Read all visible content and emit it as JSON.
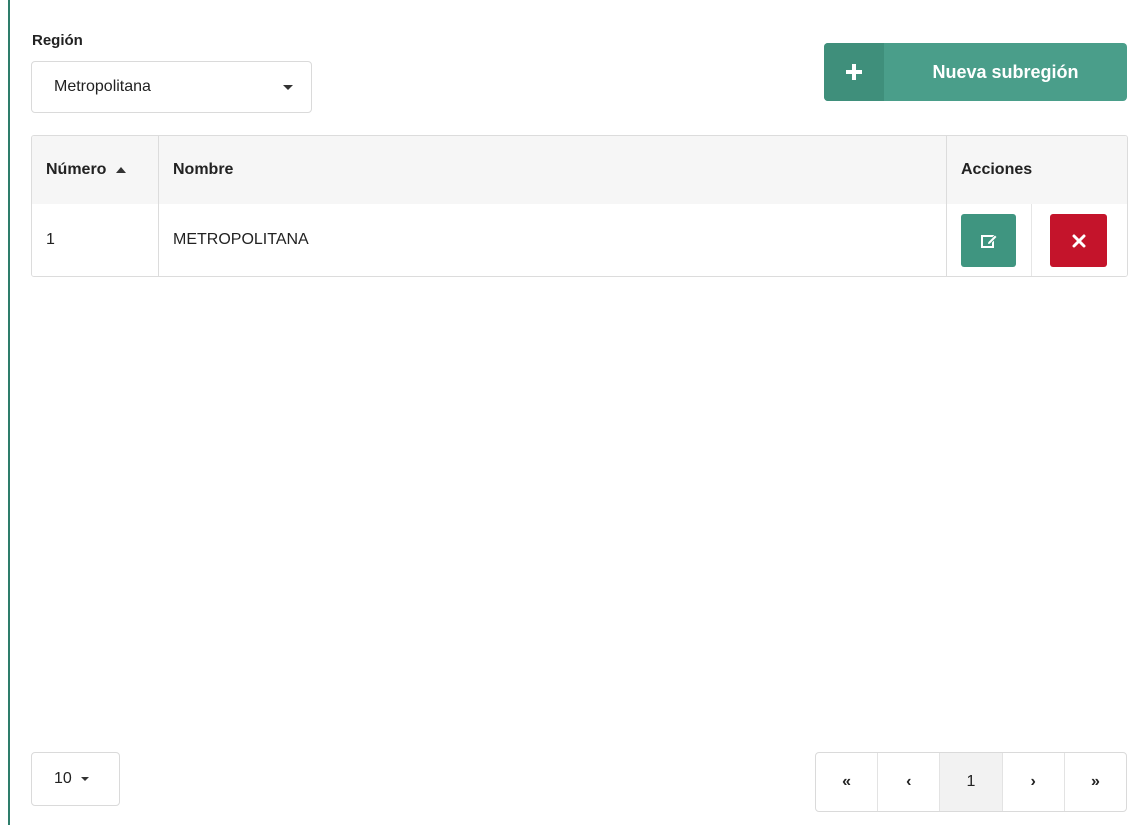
{
  "filter": {
    "label": "Región",
    "selected": "Metropolitana"
  },
  "toolbar": {
    "new_label": "Nueva subregión"
  },
  "table": {
    "columns": {
      "number": "Número",
      "name": "Nombre",
      "actions": "Acciones"
    },
    "rows": [
      {
        "number": "1",
        "name": "METROPOLITANA"
      }
    ]
  },
  "pagination": {
    "page_size": "10",
    "first": "«",
    "prev": "‹",
    "current": "1",
    "next": "›",
    "last": "»"
  },
  "colors": {
    "accent": "#4a9e8a",
    "accent_dark": "#3f8f7b",
    "danger": "#c4142b",
    "rule": "#2e7d6b"
  },
  "icons": {
    "new": "plus-icon",
    "edit": "edit-icon",
    "delete": "close-icon",
    "sort": "sort-asc-icon",
    "dropdown": "chevron-down-icon"
  }
}
